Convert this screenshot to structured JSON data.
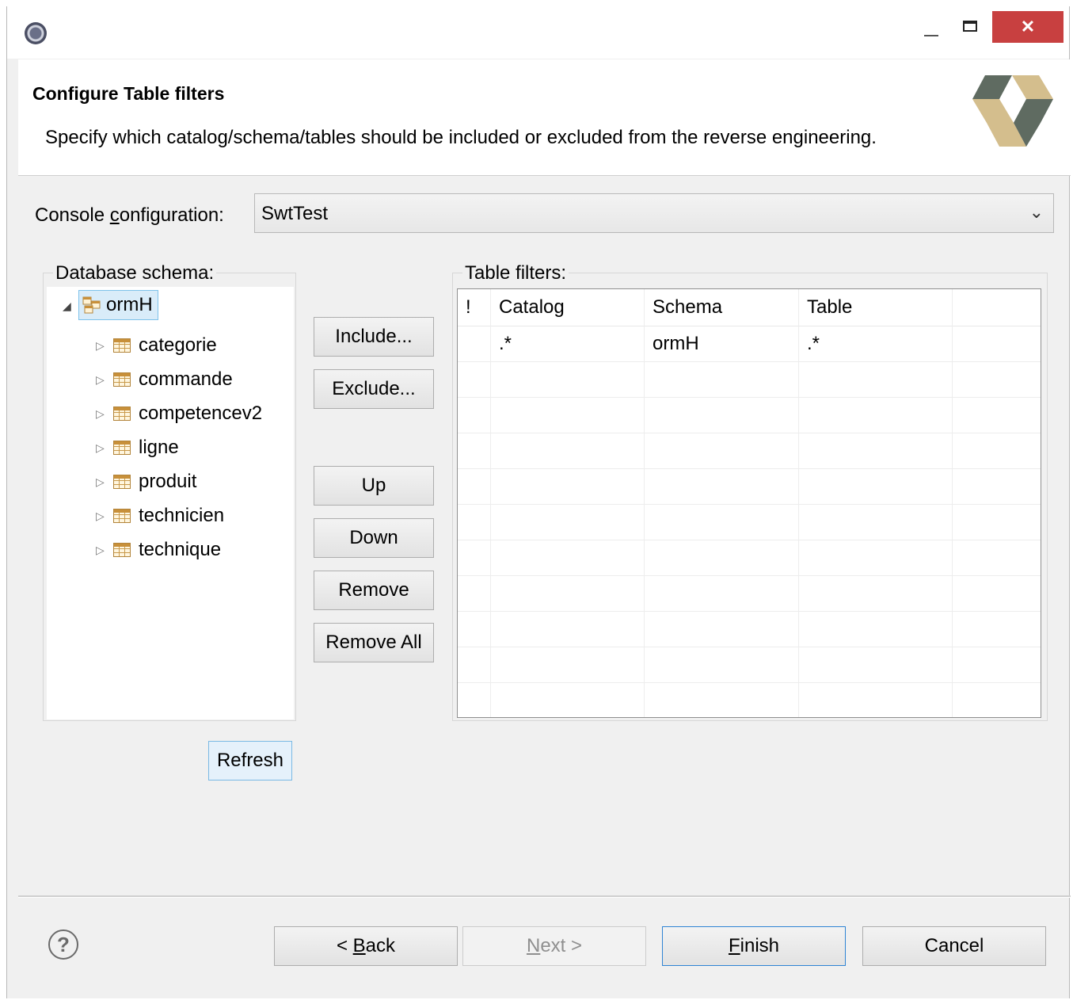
{
  "window": {
    "close_glyph": "✕"
  },
  "header": {
    "title": "Configure Table filters",
    "description": "Specify which catalog/schema/tables should be included or excluded from the reverse engineering."
  },
  "console": {
    "label_pre": "Console ",
    "label_mnemonic": "c",
    "label_post": "onfiguration:",
    "value": "SwtTest"
  },
  "schema_panel": {
    "label": "Database schema:",
    "root": "ormH",
    "tables": [
      "categorie",
      "commande",
      "competencev2",
      "ligne",
      "produit",
      "technicien",
      "technique"
    ]
  },
  "filter_buttons": {
    "include": "Include...",
    "exclude": "Exclude...",
    "up": "Up",
    "down": "Down",
    "remove": "Remove",
    "remove_all": "Remove All"
  },
  "refresh_label": "Refresh",
  "filters": {
    "label": "Table filters:",
    "columns": [
      "!",
      "Catalog",
      "Schema",
      "Table"
    ],
    "rows": [
      {
        "exclude": "",
        "catalog": ".*",
        "schema": "ormH",
        "table": ".*"
      }
    ]
  },
  "footer": {
    "back_pre": "< ",
    "back_mnemonic": "B",
    "back_post": "ack",
    "next_mnemonic": "N",
    "next_post": "ext >",
    "finish_mnemonic": "F",
    "finish_post": "inish",
    "cancel": "Cancel",
    "help_glyph": "?"
  }
}
